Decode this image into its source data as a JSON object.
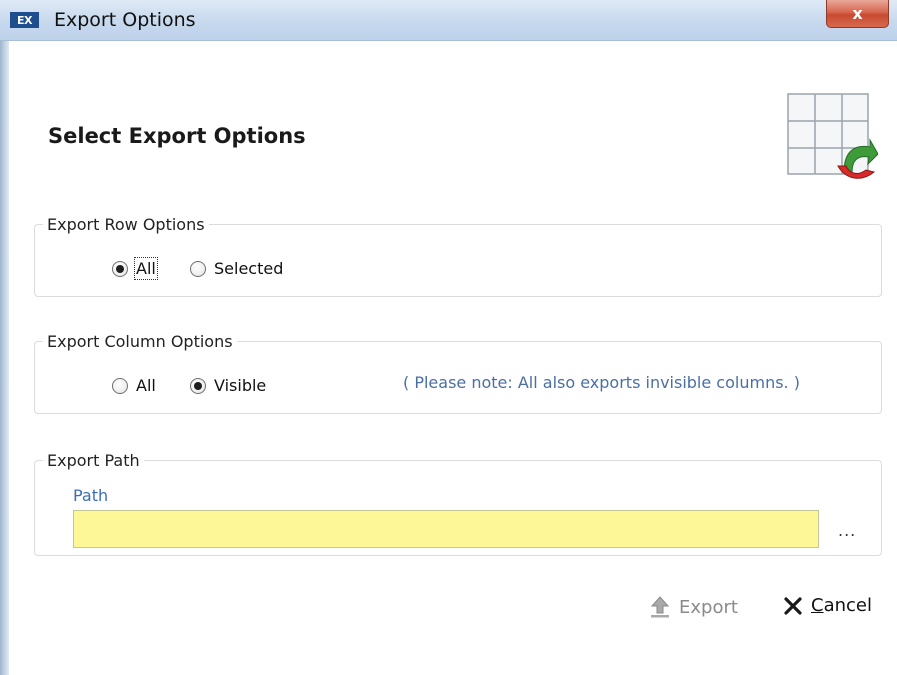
{
  "window": {
    "app_icon_text": "EX",
    "title": "Export Options",
    "close_label": "x"
  },
  "header": {
    "heading": "Select Export Options",
    "icon": "export-grid-icon"
  },
  "row_options": {
    "title": "Export Row Options",
    "options": [
      {
        "label": "All",
        "checked": true
      },
      {
        "label": "Selected",
        "checked": false
      }
    ]
  },
  "column_options": {
    "title": "Export Column Options",
    "options": [
      {
        "label": "All",
        "checked": false
      },
      {
        "label": "Visible",
        "checked": true
      }
    ],
    "note": "( Please note: All also exports invisible columns. )"
  },
  "export_path": {
    "title": "Export Path",
    "field_label": "Path",
    "value": "",
    "browse_label": "..."
  },
  "buttons": {
    "export_label": "Export",
    "export_icon": "upload-arrow-icon",
    "cancel_label": "Cancel",
    "cancel_icon": "x-icon"
  },
  "colors": {
    "path_field_bg": "#fdf797",
    "label_blue": "#3d6db5"
  }
}
